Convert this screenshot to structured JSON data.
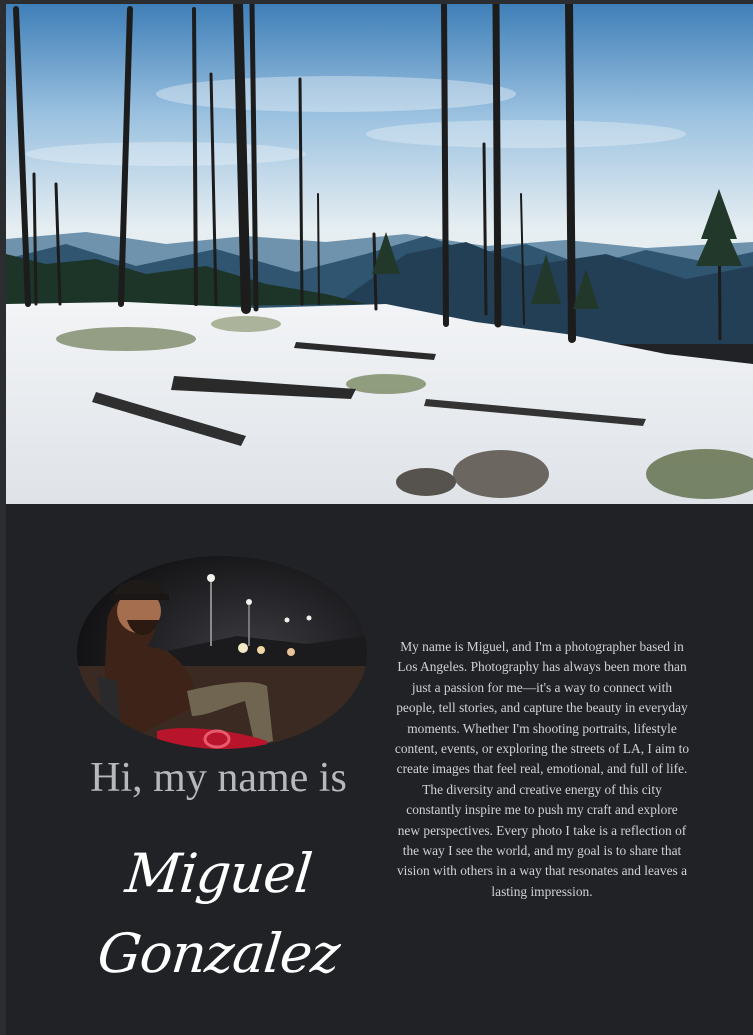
{
  "about": {
    "greeting": "Hi, my name is",
    "first_name": "Miguel",
    "last_name": "Gonzalez",
    "bio": "My name is Miguel, and I'm a photographer based in Los Angeles. Photography has always been more than just a passion for me—it's a way to connect with people, tell stories, and capture the beauty in everyday moments. Whether I'm shooting portraits, lifestyle content, events, or exploring the streets of LA, I aim to create images that feel real, emotional, and full of life. The diversity and creative energy of this city constantly inspire me to push my craft and explore new perspectives. Every photo I take is a reflection of the way I see the world, and my goal is to share that vision with others in a way that resonates and leaves a lasting impression."
  },
  "colors": {
    "background": "#202226",
    "greeting_text": "#b8b8bc",
    "name_text": "#ffffff",
    "bio_text": "#d2d2d4"
  }
}
